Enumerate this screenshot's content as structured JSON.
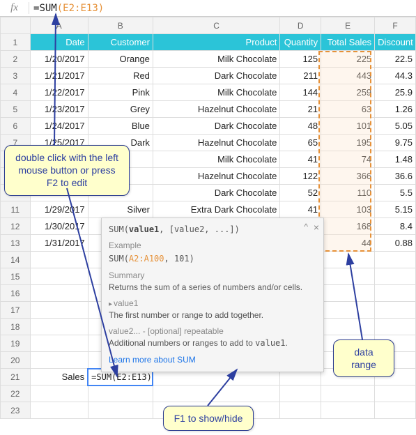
{
  "formula_bar": {
    "fx": "fx",
    "eq": "=",
    "fn": "SUM",
    "open": "(",
    "range": "E2:E13",
    "close": ")"
  },
  "columns": {
    "A": "A",
    "B": "B",
    "C": "C",
    "D": "D",
    "E": "E",
    "F": "F"
  },
  "row_nums": [
    "1",
    "2",
    "3",
    "4",
    "5",
    "6",
    "7",
    "8",
    "9",
    "10",
    "11",
    "12",
    "13",
    "14",
    "15",
    "16",
    "17",
    "18",
    "19",
    "20",
    "21",
    "22",
    "23"
  ],
  "headers": {
    "a": "Date",
    "b": "Customer",
    "c": "Product",
    "d": "Quantity",
    "e": "Total Sales",
    "f": "Discount"
  },
  "rows": [
    {
      "a": "1/20/2017",
      "b": "Orange",
      "c": "Milk Chocolate",
      "d": "125",
      "e": "225",
      "f": "22.5"
    },
    {
      "a": "1/21/2017",
      "b": "Red",
      "c": "Dark Chocolate",
      "d": "211",
      "e": "443",
      "f": "44.3"
    },
    {
      "a": "1/22/2017",
      "b": "Pink",
      "c": "Milk Chocolate",
      "d": "144",
      "e": "259",
      "f": "25.9"
    },
    {
      "a": "1/23/2017",
      "b": "Grey",
      "c": "Hazelnut Chocolate",
      "d": "21",
      "e": "63",
      "f": "1.26"
    },
    {
      "a": "1/24/2017",
      "b": "Blue",
      "c": "Dark Chocolate",
      "d": "48",
      "e": "101",
      "f": "5.05"
    },
    {
      "a": "1/25/2017",
      "b": "Dark",
      "c": "Hazelnut Chocolate",
      "d": "65",
      "e": "195",
      "f": "9.75"
    },
    {
      "a": "",
      "b": "",
      "c": "Milk Chocolate",
      "d": "41",
      "e": "74",
      "f": "1.48"
    },
    {
      "a": "",
      "b": "",
      "c": "Hazelnut Chocolate",
      "d": "122",
      "e": "366",
      "f": "36.6"
    },
    {
      "a": "",
      "b": "",
      "c": "Dark Chocolate",
      "d": "52",
      "e": "110",
      "f": "5.5"
    },
    {
      "a": "1/29/2017",
      "b": "Silver",
      "c": "Extra Dark Chocolate",
      "d": "41",
      "e": "103",
      "f": "5.15"
    },
    {
      "a": "1/30/2017",
      "b": "",
      "c": "",
      "d": "",
      "e": "168",
      "f": "8.4"
    },
    {
      "a": "1/31/2017",
      "b": "",
      "c": "",
      "d": "",
      "e": "44",
      "f": "0.88"
    }
  ],
  "sales_row": {
    "label": "Sales",
    "formula": "=SUM(E2:E13)"
  },
  "tooltip": {
    "sig_fn": "SUM",
    "sig_p1": "value1",
    "sig_rest": ", [value2, ...]",
    "example_head": "Example",
    "example_fn": "SUM",
    "example_range": "A2:A100",
    "example_rest": ", 101",
    "summary_head": "Summary",
    "summary_text": "Returns the sum of a series of numbers and/or cells.",
    "v1_head": "value1",
    "v1_text": "The first number or range to add together.",
    "v2_head": "value2... - [optional] repeatable",
    "v2_text_a": "Additional numbers or ranges to add to ",
    "v2_text_code": "value1",
    "v2_text_b": ".",
    "link": "Learn more about SUM"
  },
  "callouts": {
    "edit": "double click with the left mouse button or press F2 to edit",
    "range": "data range",
    "f1": "F1 to show/hide"
  }
}
